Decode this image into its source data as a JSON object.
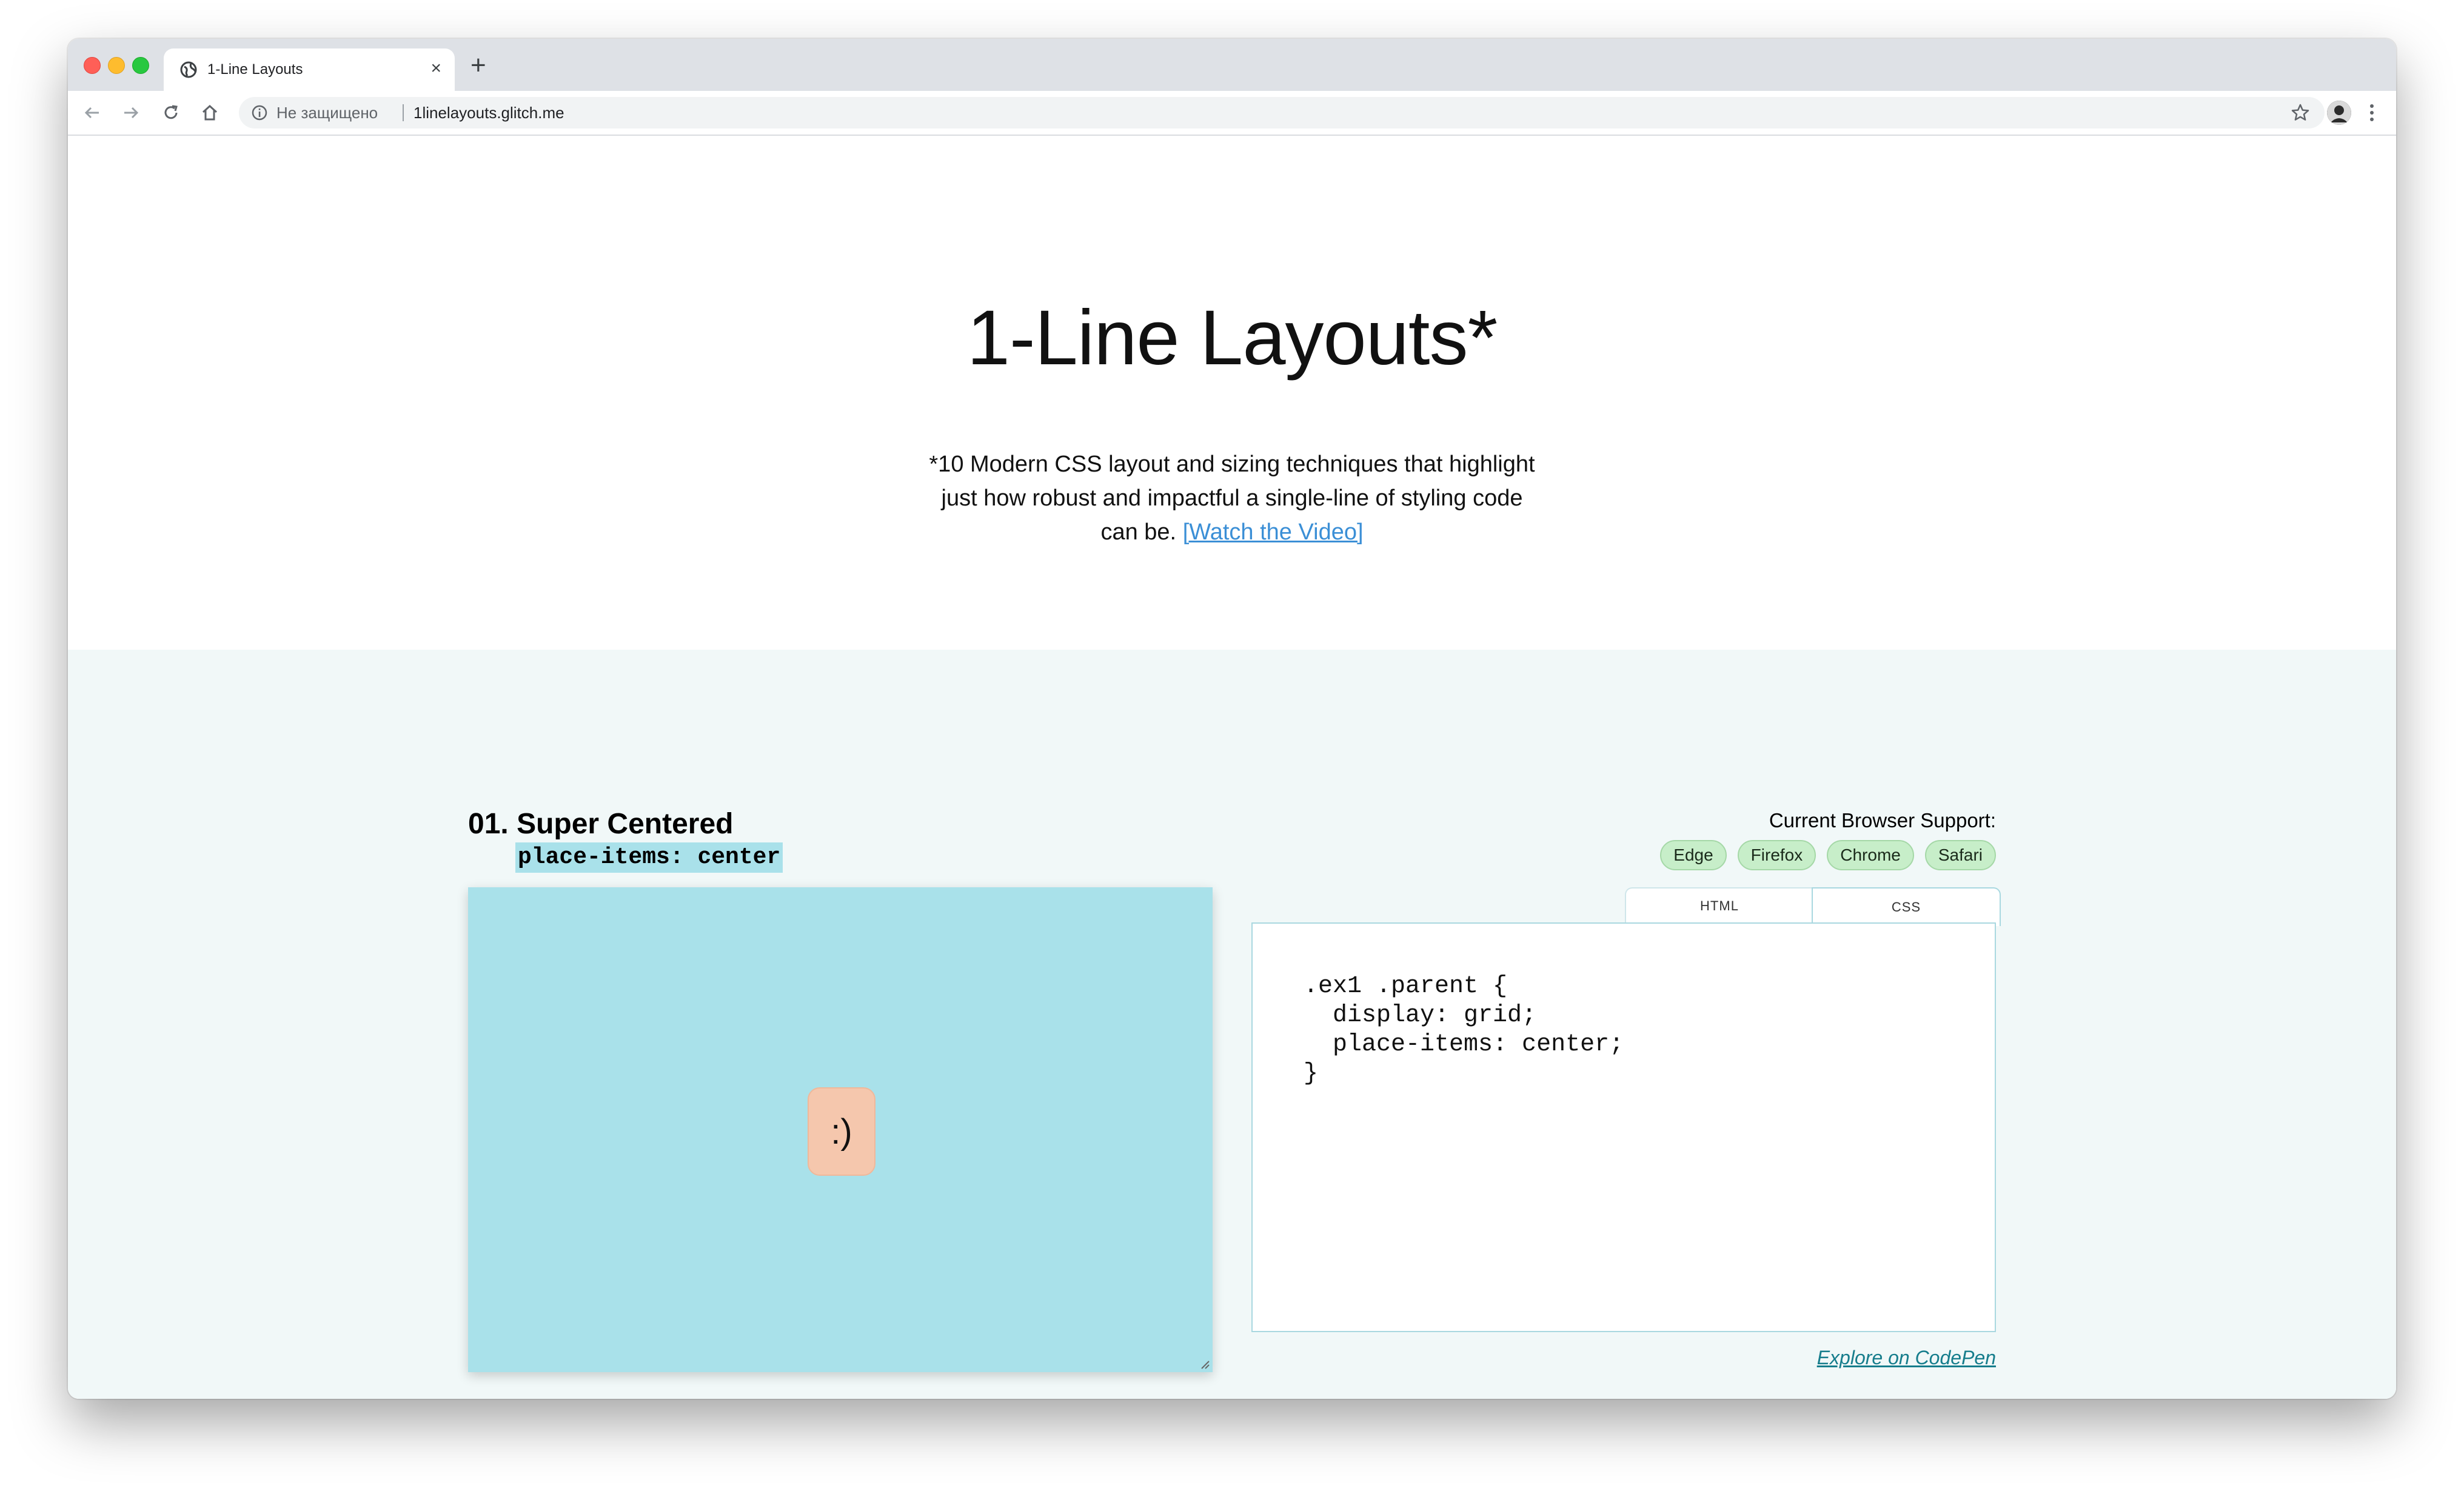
{
  "browser": {
    "tab_title": "1-Line Layouts",
    "tab_close": "×",
    "new_tab": "+",
    "security_text": "Не защищено",
    "url": "1linelayouts.glitch.me"
  },
  "hero": {
    "title": "1-Line Layouts*",
    "subtitle": "*10 Modern CSS layout and sizing techniques that highlight just how robust and impactful a single-line of styling code can be.",
    "video_link": "[Watch the Video]"
  },
  "example": {
    "heading": "01. Super Centered",
    "code_label": "place-items: center",
    "support_label": "Current Browser Support:",
    "browsers": [
      "Edge",
      "Firefox",
      "Chrome",
      "Safari"
    ],
    "demo_content": ":)",
    "tabs": {
      "html": "HTML",
      "css": "CSS"
    },
    "css_code": ".ex1 .parent {\n  display: grid;\n  place-items: center;\n}",
    "codepen_link": "Explore on CodePen"
  },
  "colors": {
    "demo_bg": "#a9e1ea",
    "section_bg": "#f1f8f8",
    "badge_bg": "#c7eec9",
    "child_bg": "#f5c7ad",
    "link": "#3b8fd6"
  }
}
